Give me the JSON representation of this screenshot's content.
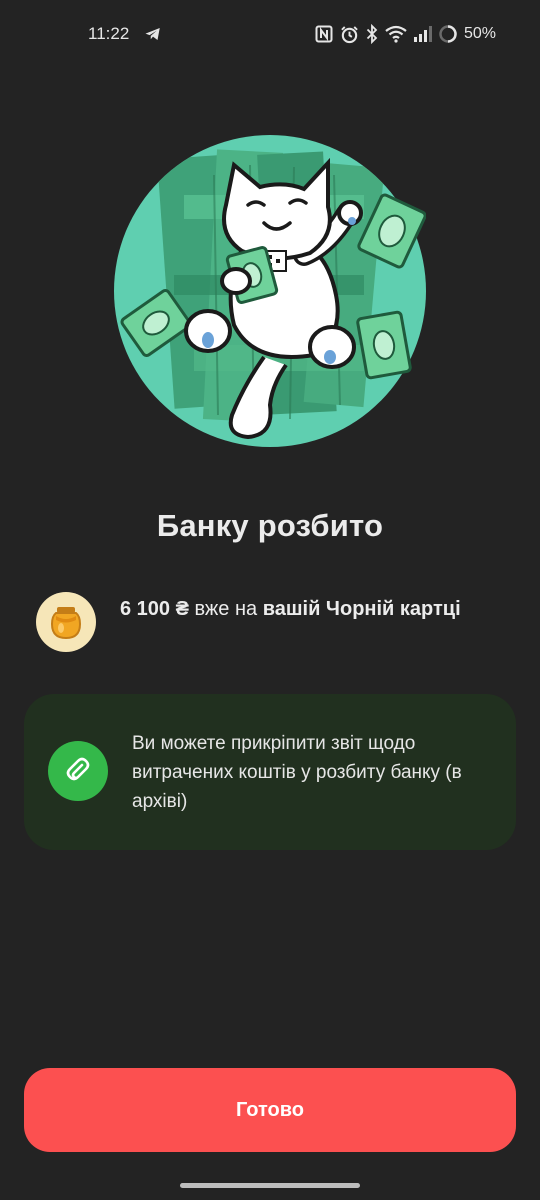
{
  "status_bar": {
    "time": "11:22",
    "battery": "50%",
    "icons": [
      "telegram-icon",
      "nfc-icon",
      "alarm-icon",
      "bluetooth-icon",
      "wifi-icon",
      "signal-icon",
      "battery-icon"
    ]
  },
  "hero": {
    "image": "cat-lying-on-money-illustration"
  },
  "title": "Банку розбито",
  "amount": {
    "value": "6 100 ₴",
    "text_middle": " вже на ",
    "card_bold": "вашій Чорній картці",
    "icon": "honey-jar-icon"
  },
  "info_card": {
    "text": "Ви можете прикріпити звіт щодо витрачених коштів у розбиту банку (в архіві)",
    "icon": "paperclip-icon"
  },
  "button": {
    "label": "Готово"
  },
  "colors": {
    "background": "#232323",
    "accent_button": "#fc5050",
    "card_background": "#21301f",
    "clip_green": "#34b84a",
    "hero_circle": "#5fcfb0"
  }
}
